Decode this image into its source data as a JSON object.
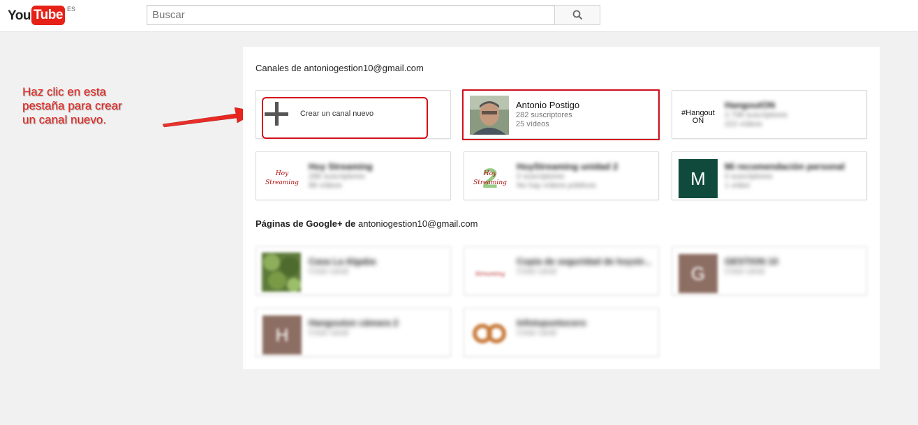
{
  "header": {
    "logo_you": "You",
    "logo_tube": "Tube",
    "logo_country": "ES",
    "search_placeholder": "Buscar"
  },
  "channels_section": {
    "title_prefix": "Canales de",
    "email": "antoniogestion10@gmail.com",
    "create_label": "Crear un canal nuevo",
    "cards": [
      {
        "name": "Antonio Postigo",
        "line1": "282 suscriptores",
        "line2": "25 vídeos"
      },
      {
        "name": "HangoutON",
        "line1": "2.798 suscriptores",
        "line2": "222 vídeos",
        "thumb_text": "#Hangout ON"
      },
      {
        "name": "Hoy Streaming",
        "line1": "286 suscriptores",
        "line2": "88 vídeos",
        "thumb_text": "Hoy Streaming"
      },
      {
        "name": "HoyStreaming unidad 2",
        "line1": "0 suscriptores",
        "line2": "No hay vídeos públicos",
        "thumb_text": "Hoy Streaming"
      },
      {
        "name": "Mi recomendación personal",
        "line1": "0 suscriptores",
        "line2": "1 vídeo",
        "thumb_letter": "M"
      }
    ]
  },
  "pages_section": {
    "title_prefix": "Páginas de Google+ de",
    "email": "antoniogestion10@gmail.com",
    "cards": [
      {
        "name": "Casa La Algaba",
        "line1": "Crear canal"
      },
      {
        "name": "Copia de seguridad de hoystr...",
        "line1": "Crear canal",
        "thumb_text": "Streaming"
      },
      {
        "name": "GESTION 10",
        "line1": "Crear canal",
        "thumb_letter": "G"
      },
      {
        "name": "Hangouton cámara 2",
        "line1": "Crear canal",
        "thumb_letter": "H"
      },
      {
        "name": "Infotopuntocero",
        "line1": "Crear canal"
      }
    ]
  },
  "annotation": {
    "line1": "Haz clic en esta",
    "line2": "pestaña para crear",
    "line3": "un canal nuevo."
  },
  "colors": {
    "accent_red": "#e62117",
    "highlight_red": "#d10f1a",
    "annotation_red": "#e8201a",
    "tile_M": "#0f4a3c",
    "tile_G_H": "#8d6e63"
  },
  "icons": {
    "search": "magnifier-icon",
    "create": "plus-icon"
  }
}
